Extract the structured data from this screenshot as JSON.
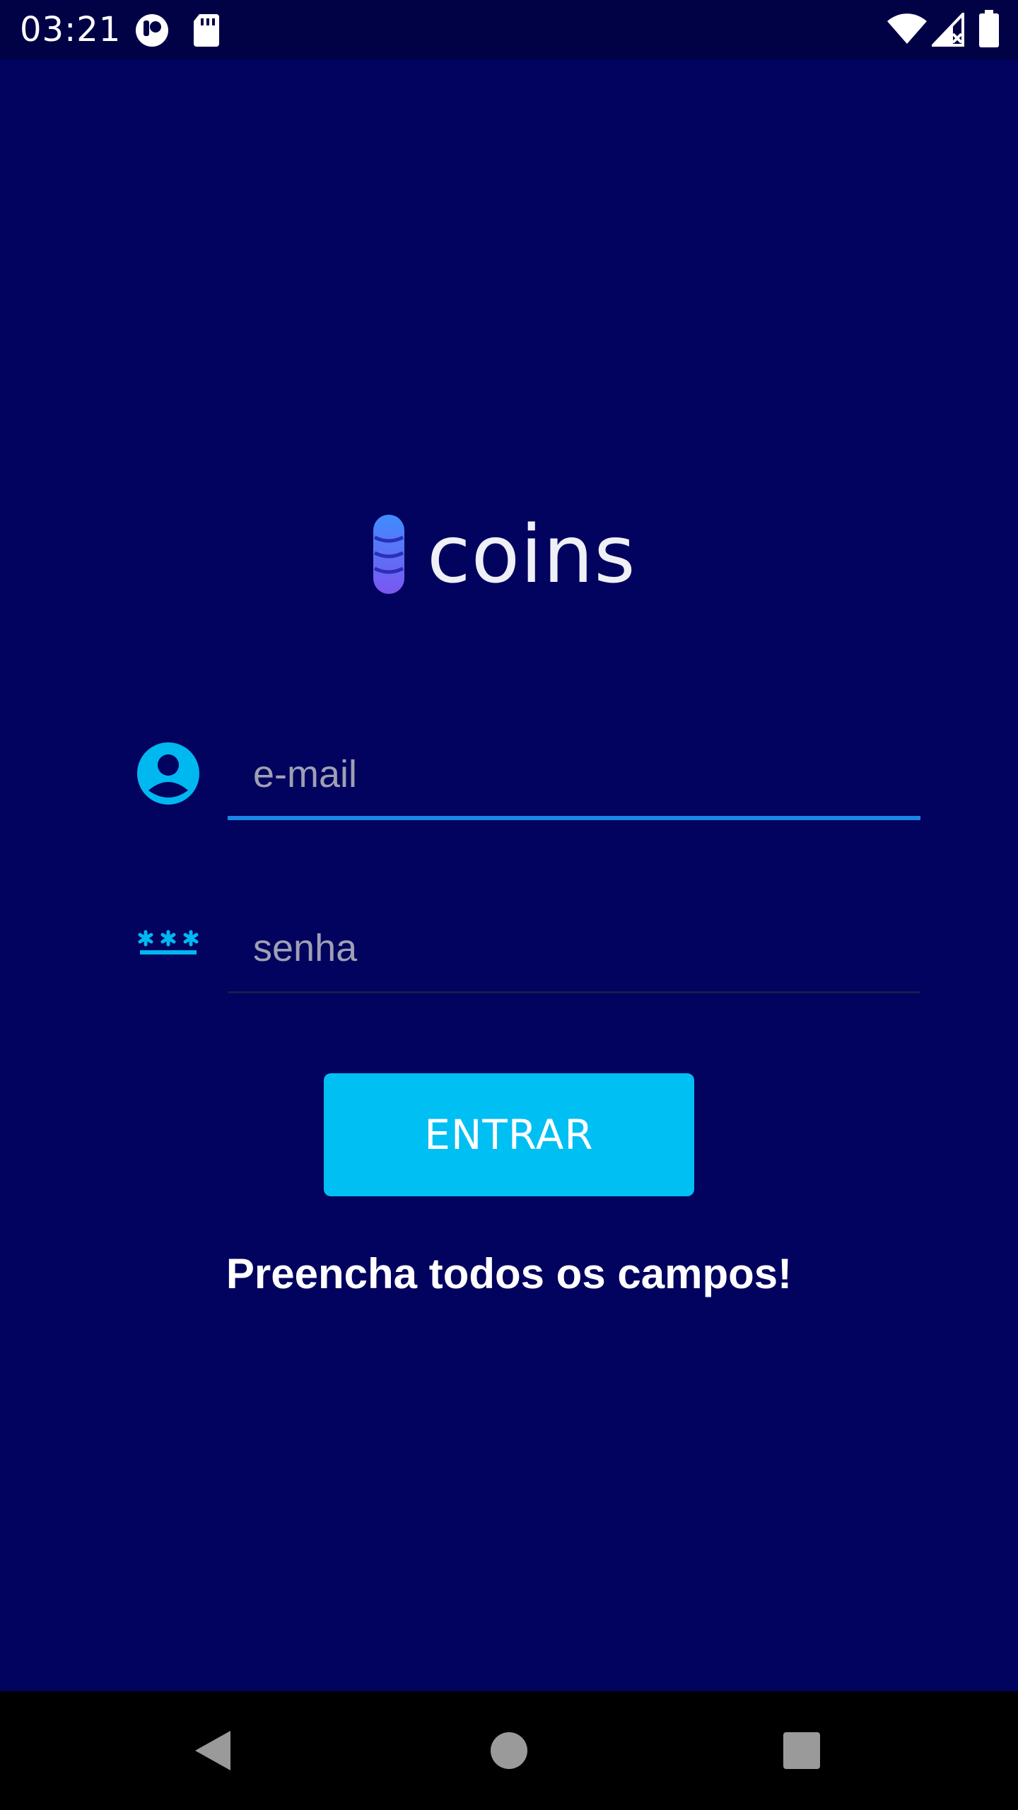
{
  "status_bar": {
    "time": "03:21",
    "icons": [
      "app-notification-icon",
      "sd-card-icon",
      "wifi-icon",
      "cell-signal-icon",
      "battery-icon"
    ]
  },
  "logo": {
    "text": "coins",
    "icon": "coin-stack-icon"
  },
  "form": {
    "email": {
      "icon": "account-circle-icon",
      "placeholder": "e-mail",
      "value": ""
    },
    "password": {
      "icon": "password-asterisk-icon",
      "placeholder": "senha",
      "value": ""
    },
    "submit_label": "ENTRAR",
    "message": "Preencha todos os campos!"
  },
  "nav_bar": {
    "buttons": [
      "back-icon",
      "home-icon",
      "recents-icon"
    ]
  },
  "colors": {
    "background": "#02025f",
    "status_bar": "#010146",
    "accent": "#00bff3",
    "focused_underline": "#1a86e6"
  }
}
